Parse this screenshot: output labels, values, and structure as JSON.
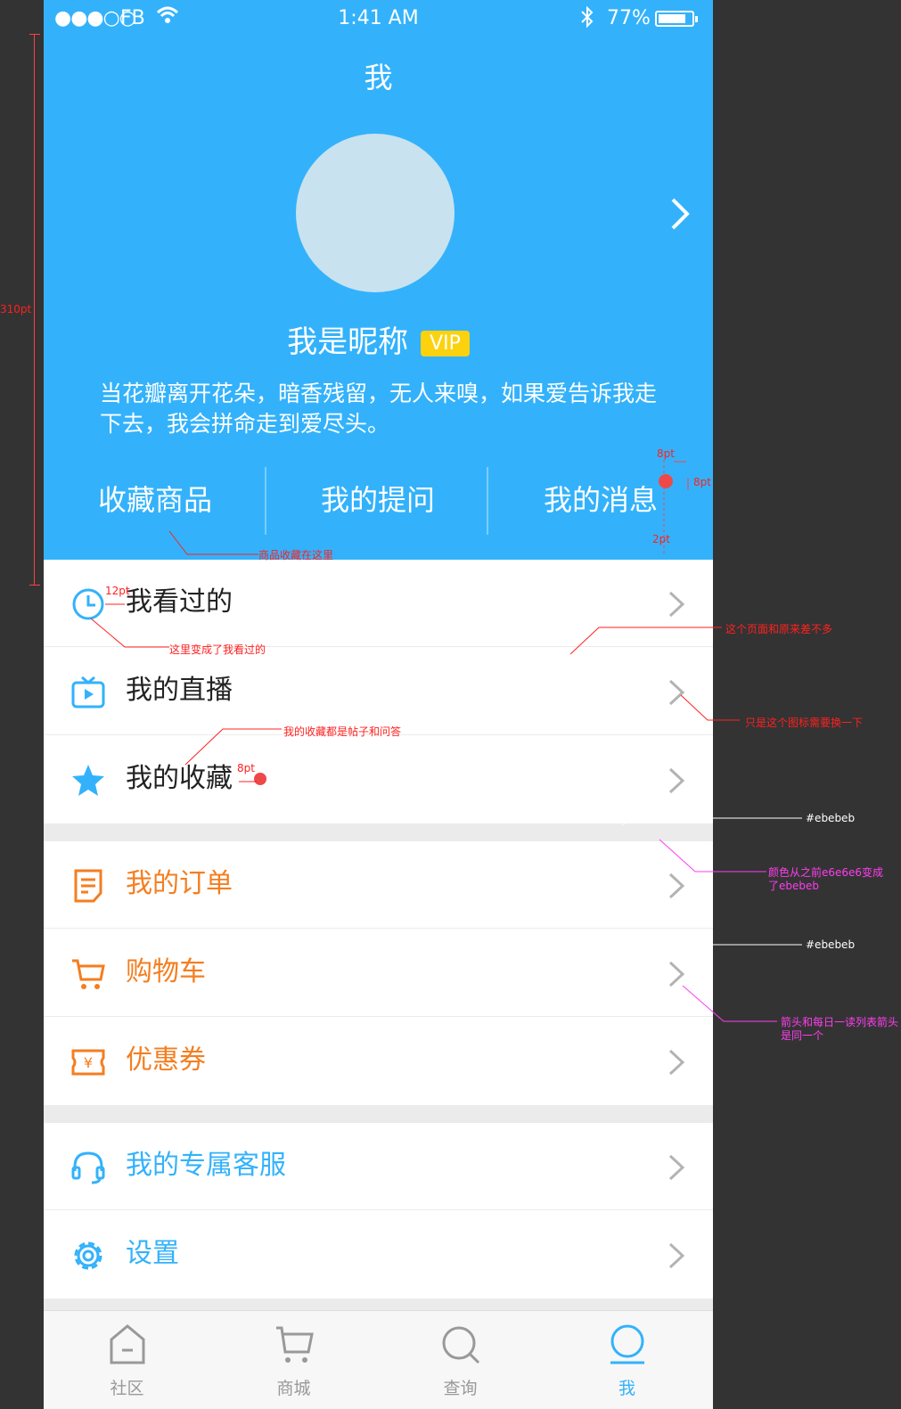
{
  "status_bar": {
    "signal": "●●●○○",
    "carrier": "FB",
    "time": "1:41 AM",
    "battery": "77%"
  },
  "header": {
    "title": "我",
    "nickname": "我是昵称",
    "vip_badge": "VIP",
    "bio": "当花瓣离开花朵，暗香残留，无人来嗅，如果爱告诉我走下去，我会拼命走到爱尽头。",
    "tabs": [
      "收藏商品",
      "我的提问",
      "我的消息"
    ]
  },
  "menu": {
    "group1": [
      {
        "label": "我看过的",
        "icon": "clock-icon"
      },
      {
        "label": "我的直播",
        "icon": "tv-play-icon"
      },
      {
        "label": "我的收藏",
        "icon": "star-icon"
      }
    ],
    "group2": [
      {
        "label": "我的订单",
        "icon": "order-doc-icon"
      },
      {
        "label": "购物车",
        "icon": "cart-icon"
      },
      {
        "label": "优惠券",
        "icon": "coupon-icon"
      }
    ],
    "group3": [
      {
        "label": "我的专属客服",
        "icon": "headset-icon"
      },
      {
        "label": "设置",
        "icon": "gear-icon"
      }
    ]
  },
  "tabbar": {
    "items": [
      {
        "label": "社区",
        "icon": "home-icon"
      },
      {
        "label": "商城",
        "icon": "cart-icon"
      },
      {
        "label": "查询",
        "icon": "search-icon"
      },
      {
        "label": "我",
        "icon": "profile-icon"
      }
    ],
    "active": "我"
  },
  "annotations": {
    "height_310": "310pt",
    "pt8_a": "8pt",
    "pt8_b": "8pt",
    "pt2": "2pt",
    "fav_goods": "商品收藏在这里",
    "pt12": "12pt",
    "changed_viewed": "这里变成了我看过的",
    "similar_page": "这个页面和原来差不多",
    "icon_replace": "只是这个图标需要换一下",
    "fav_posts": "我的收藏都是帖子和问答",
    "pt8_c": "8pt",
    "color_ebebeb_1": "#ebebeb",
    "color_change": "颜色从之前e6e6e6变成了ebebeb",
    "color_ebebeb_2": "#ebebeb",
    "arrow_same": "箭头和每日一读列表箭头是同一个"
  },
  "colors": {
    "primary": "#33b2fb",
    "orange": "#f47e20",
    "divider": "#ebebeb",
    "red_dot": "#ee4949",
    "vip": "#fcd20f"
  }
}
